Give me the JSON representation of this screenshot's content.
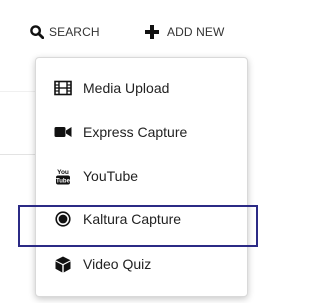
{
  "toolbar": {
    "search_label": "SEARCH",
    "search_icon": "search-icon",
    "add_new_label": "ADD NEW",
    "add_icon": "plus-icon"
  },
  "menu": {
    "items": [
      {
        "label": "Media Upload",
        "icon": "film-icon"
      },
      {
        "label": "Express Capture",
        "icon": "video-camera-icon"
      },
      {
        "label": "YouTube",
        "icon": "youtube-icon"
      },
      {
        "label": "Kaltura Capture",
        "icon": "record-icon"
      },
      {
        "label": "Video Quiz",
        "icon": "cube-icon"
      }
    ],
    "highlighted_index": 3,
    "highlight_color": "#2b2a85"
  }
}
